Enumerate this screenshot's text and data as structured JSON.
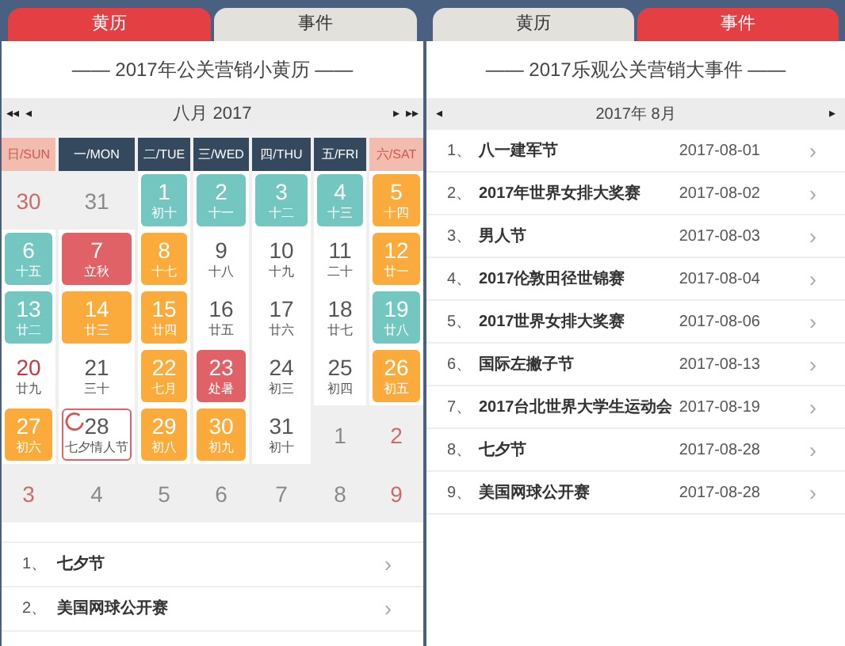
{
  "left_panel": {
    "tabs": [
      {
        "label": "黄历",
        "selected": true
      },
      {
        "label": "事件",
        "selected": false
      }
    ],
    "title": "—— 2017年公关营销小黄历 ——",
    "nav": {
      "first": "◂◂",
      "prev": "◂",
      "month": "八月 2017",
      "next": "▸",
      "last": "▸▸"
    },
    "weekdays": [
      {
        "label": "日/SUN",
        "weekend": true
      },
      {
        "label": "一/MON",
        "weekend": false
      },
      {
        "label": "二/TUE",
        "weekend": false
      },
      {
        "label": "三/WED",
        "weekend": false
      },
      {
        "label": "四/THU",
        "weekend": false
      },
      {
        "label": "五/FRI",
        "weekend": false
      },
      {
        "label": "六/SAT",
        "weekend": true
      }
    ],
    "weeks": [
      [
        {
          "day": "30",
          "kind": "other"
        },
        {
          "day": "31",
          "kind": "other"
        },
        {
          "day": "1",
          "lunar": "初十",
          "kind": "teal"
        },
        {
          "day": "2",
          "lunar": "十一",
          "kind": "teal"
        },
        {
          "day": "3",
          "lunar": "十二",
          "kind": "teal"
        },
        {
          "day": "4",
          "lunar": "十三",
          "kind": "teal"
        },
        {
          "day": "5",
          "lunar": "十四",
          "kind": "orange"
        }
      ],
      [
        {
          "day": "6",
          "lunar": "十五",
          "kind": "teal"
        },
        {
          "day": "7",
          "lunar": "立秋",
          "kind": "red"
        },
        {
          "day": "8",
          "lunar": "十七",
          "kind": "orange"
        },
        {
          "day": "9",
          "lunar": "十八",
          "kind": "plain"
        },
        {
          "day": "10",
          "lunar": "十九",
          "kind": "plain"
        },
        {
          "day": "11",
          "lunar": "二十",
          "kind": "plain"
        },
        {
          "day": "12",
          "lunar": "廿一",
          "kind": "orange"
        }
      ],
      [
        {
          "day": "13",
          "lunar": "廿二",
          "kind": "teal"
        },
        {
          "day": "14",
          "lunar": "廿三",
          "kind": "orange"
        },
        {
          "day": "15",
          "lunar": "廿四",
          "kind": "orange"
        },
        {
          "day": "16",
          "lunar": "廿五",
          "kind": "plain"
        },
        {
          "day": "17",
          "lunar": "廿六",
          "kind": "plain"
        },
        {
          "day": "18",
          "lunar": "廿七",
          "kind": "plain"
        },
        {
          "day": "19",
          "lunar": "廿八",
          "kind": "teal"
        }
      ],
      [
        {
          "day": "20",
          "lunar": "廿九",
          "kind": "plain"
        },
        {
          "day": "21",
          "lunar": "三十",
          "kind": "plain"
        },
        {
          "day": "22",
          "lunar": "七月",
          "kind": "orange"
        },
        {
          "day": "23",
          "lunar": "处暑",
          "kind": "red"
        },
        {
          "day": "24",
          "lunar": "初三",
          "kind": "plain"
        },
        {
          "day": "25",
          "lunar": "初四",
          "kind": "plain"
        },
        {
          "day": "26",
          "lunar": "初五",
          "kind": "orange"
        }
      ],
      [
        {
          "day": "27",
          "lunar": "初六",
          "kind": "orange"
        },
        {
          "day": "28",
          "lunar": "七夕情人节",
          "kind": "today"
        },
        {
          "day": "29",
          "lunar": "初八",
          "kind": "orange"
        },
        {
          "day": "30",
          "lunar": "初九",
          "kind": "orange"
        },
        {
          "day": "31",
          "lunar": "初十",
          "kind": "plain"
        },
        {
          "day": "1",
          "kind": "other"
        },
        {
          "day": "2",
          "kind": "other"
        }
      ],
      [
        {
          "day": "3",
          "kind": "other"
        },
        {
          "day": "4",
          "kind": "other"
        },
        {
          "day": "5",
          "kind": "other"
        },
        {
          "day": "6",
          "kind": "other"
        },
        {
          "day": "7",
          "kind": "other"
        },
        {
          "day": "8",
          "kind": "other"
        },
        {
          "day": "9",
          "kind": "other"
        }
      ]
    ],
    "events": [
      {
        "index": "1、",
        "name": "七夕节",
        "chevron": "›"
      },
      {
        "index": "2、",
        "name": "美国网球公开赛",
        "chevron": "›"
      }
    ]
  },
  "right_panel": {
    "tabs": [
      {
        "label": "黄历",
        "selected": false
      },
      {
        "label": "事件",
        "selected": true
      }
    ],
    "title": "—— 2017乐观公关营销大事件 ——",
    "nav": {
      "prev": "◂",
      "month": "2017年 8月",
      "next": "▸"
    },
    "events": [
      {
        "index": "1、",
        "name": "八一建军节",
        "date": "2017-08-01",
        "chevron": "›"
      },
      {
        "index": "2、",
        "name": "2017年世界女排大奖赛",
        "date": "2017-08-02",
        "chevron": "›"
      },
      {
        "index": "3、",
        "name": "男人节",
        "date": "2017-08-03",
        "chevron": "›"
      },
      {
        "index": "4、",
        "name": "2017伦敦田径世锦赛",
        "date": "2017-08-04",
        "chevron": "›"
      },
      {
        "index": "5、",
        "name": "2017世界女排大奖赛",
        "date": "2017-08-06",
        "chevron": "›"
      },
      {
        "index": "6、",
        "name": "国际左撇子节",
        "date": "2017-08-13",
        "chevron": "›"
      },
      {
        "index": "7、",
        "name": "2017台北世界大学生运动会",
        "date": "2017-08-19",
        "chevron": "›"
      },
      {
        "index": "8、",
        "name": "七夕节",
        "date": "2017-08-28",
        "chevron": "›"
      },
      {
        "index": "9、",
        "name": "美国网球公开赛",
        "date": "2017-08-28",
        "chevron": "›"
      }
    ]
  }
}
